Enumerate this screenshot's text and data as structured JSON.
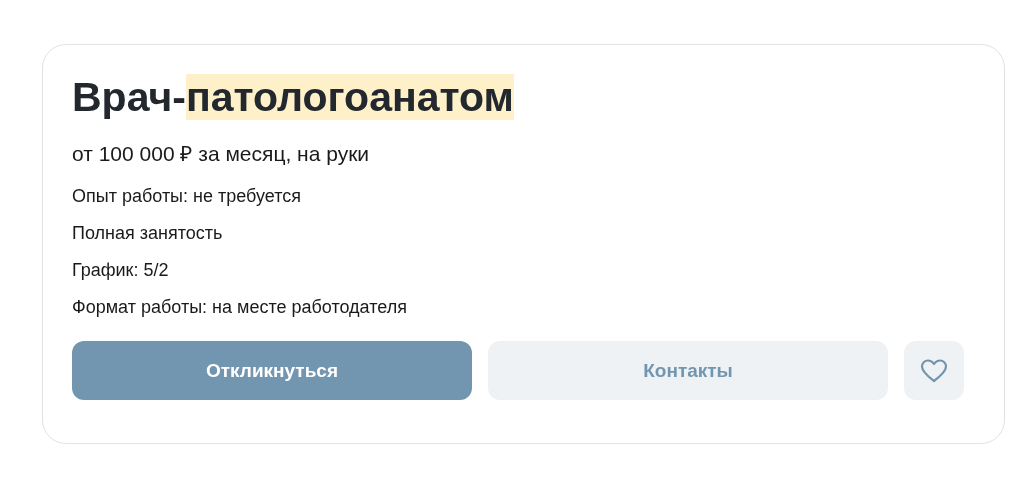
{
  "vacancy": {
    "title_parts": [
      {
        "text": "Врач-",
        "highlighted": false
      },
      {
        "text": "патологоанатом",
        "highlighted": true
      }
    ],
    "salary": "от 100 000 ₽ за месяц, на руки",
    "details": [
      "Опыт работы: не требуется",
      "Полная занятость",
      "График: 5/2",
      "Формат работы: на месте работодателя"
    ],
    "buttons": [
      {
        "kind": "primary",
        "label": "Откликнуться"
      },
      {
        "kind": "secondary",
        "label": "Контакты"
      },
      {
        "kind": "favorite"
      }
    ]
  }
}
